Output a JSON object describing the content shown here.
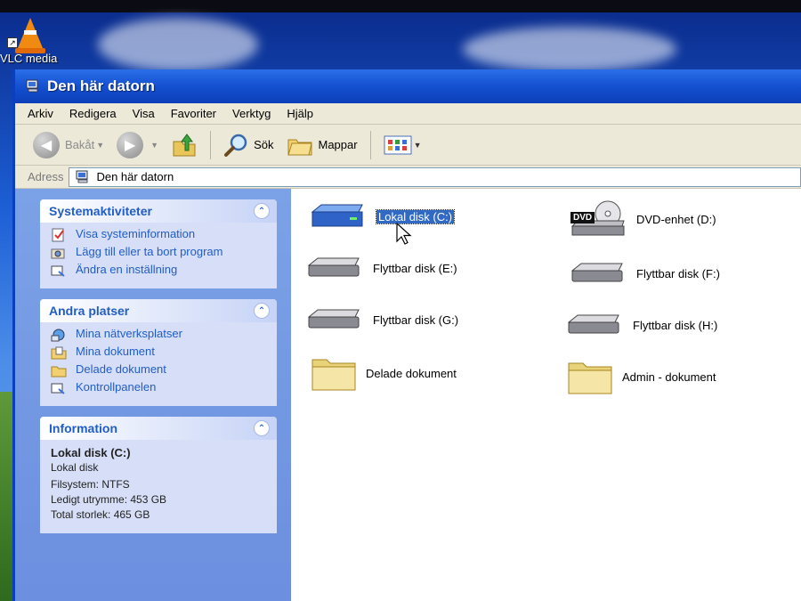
{
  "desktop": {
    "vlc_label": "VLC media"
  },
  "window": {
    "title": "Den här datorn"
  },
  "menu": [
    "Arkiv",
    "Redigera",
    "Visa",
    "Favoriter",
    "Verktyg",
    "Hjälp"
  ],
  "toolbar": {
    "back_label": "Bakåt",
    "search_label": "Sök",
    "folders_label": "Mappar"
  },
  "address": {
    "label": "Adress",
    "value": "Den här datorn"
  },
  "taskpane": {
    "system": {
      "title": "Systemaktiviteter",
      "items": [
        "Visa systeminformation",
        "Lägg till eller ta bort program",
        "Ändra en inställning"
      ]
    },
    "other_places": {
      "title": "Andra platser",
      "items": [
        "Mina nätverksplatser",
        "Mina dokument",
        "Delade dokument",
        "Kontrollpanelen"
      ]
    },
    "information": {
      "title": "Information",
      "name": "Lokal disk (C:)",
      "type": "Lokal disk",
      "filesystem": "Filsystem: NTFS",
      "free": "Ledigt utrymme: 453 GB",
      "total": "Total storlek: 465 GB"
    }
  },
  "items": [
    {
      "label": "Lokal disk (C:)",
      "kind": "hdd",
      "selected": true
    },
    {
      "label": "DVD-enhet (D:)",
      "kind": "dvd"
    },
    {
      "label": "Flyttbar disk (E:)",
      "kind": "removable"
    },
    {
      "label": "Flyttbar disk (F:)",
      "kind": "removable"
    },
    {
      "label": "Flyttbar disk (G:)",
      "kind": "removable"
    },
    {
      "label": "Flyttbar disk (H:)",
      "kind": "removable"
    },
    {
      "label": "Delade dokument",
      "kind": "folder"
    },
    {
      "label": "Admin - dokument",
      "kind": "folder"
    }
  ],
  "dvd_badge": "DVD"
}
